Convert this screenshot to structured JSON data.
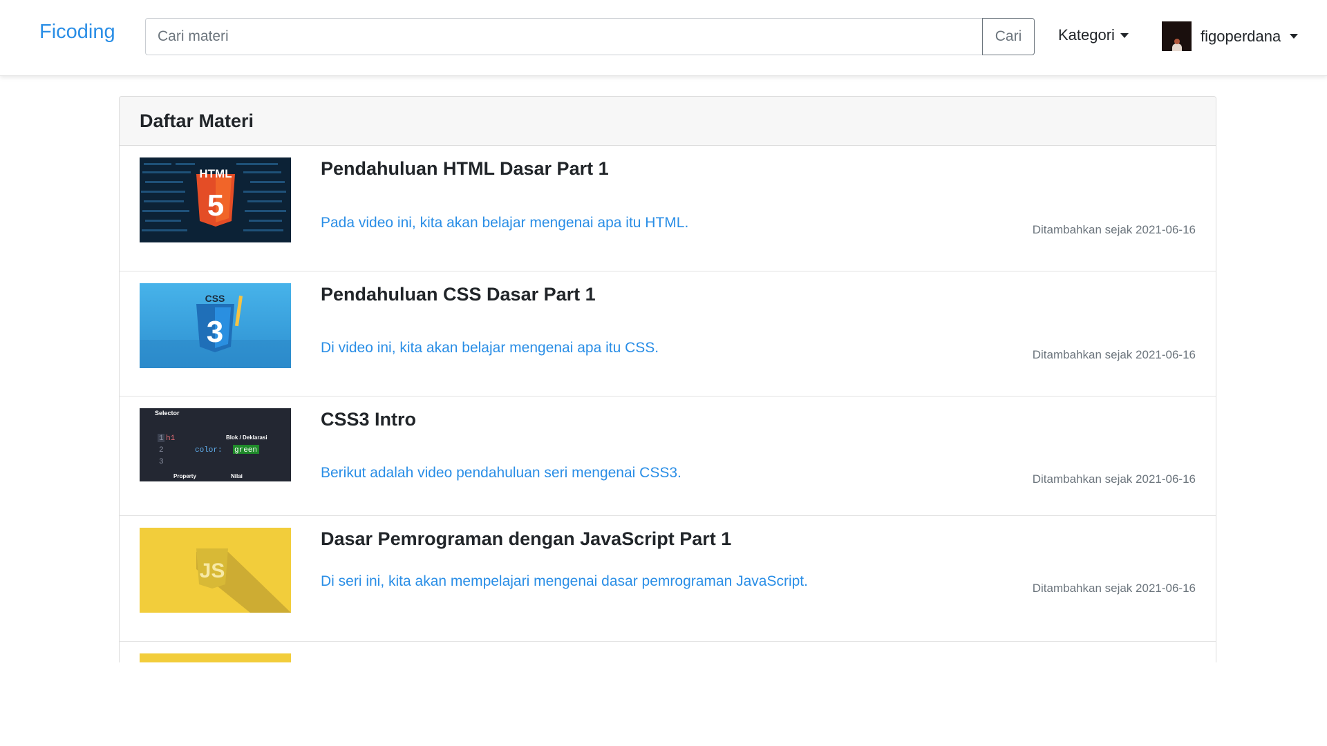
{
  "navbar": {
    "brand": "Ficoding",
    "search_placeholder": "Cari materi",
    "search_button": "Cari",
    "kategori": "Kategori",
    "username": "figoperdana"
  },
  "card": {
    "header": "Daftar Materi",
    "items": [
      {
        "title": "Pendahuluan HTML Dasar Part 1",
        "description": "Pada video ini, kita akan belajar mengenai apa itu HTML.",
        "date": "Ditambahkan sejak 2021-06-16",
        "thumb_text": "HTML",
        "thumb_badge": "5"
      },
      {
        "title": "Pendahuluan CSS Dasar Part 1",
        "description": "Di video ini, kita akan belajar mengenai apa itu CSS.",
        "date": "Ditambahkan sejak 2021-06-16",
        "thumb_text": "CSS",
        "thumb_badge": "3"
      },
      {
        "title": "CSS3 Intro",
        "description": "Berikut adalah video pendahuluan seri mengenai CSS3.",
        "date": "Ditambahkan sejak 2021-06-16",
        "thumb_selector": "Selector",
        "thumb_block": "Blok / Deklarasi",
        "thumb_line1_num": "1",
        "thumb_line1_tag": "h1",
        "thumb_line2_num": "2",
        "thumb_line2_prop": "color:",
        "thumb_line2_val": "green",
        "thumb_line3_num": "3",
        "thumb_property": "Property",
        "thumb_nilai": "Nilai"
      },
      {
        "title": "Dasar Pemrograman dengan JavaScript Part 1",
        "description": "Di seri ini, kita akan mempelajari mengenai dasar pemrograman JavaScript.",
        "date": "Ditambahkan sejak 2021-06-16",
        "thumb_text": "JS"
      }
    ]
  },
  "colors": {
    "brand": "#2a8ee6",
    "link": "#2a8ee6",
    "muted": "#6c757d",
    "html_orange": "#e44d26",
    "css_blue": "#1f6fb8",
    "js_yellow": "#f2cd3b"
  }
}
